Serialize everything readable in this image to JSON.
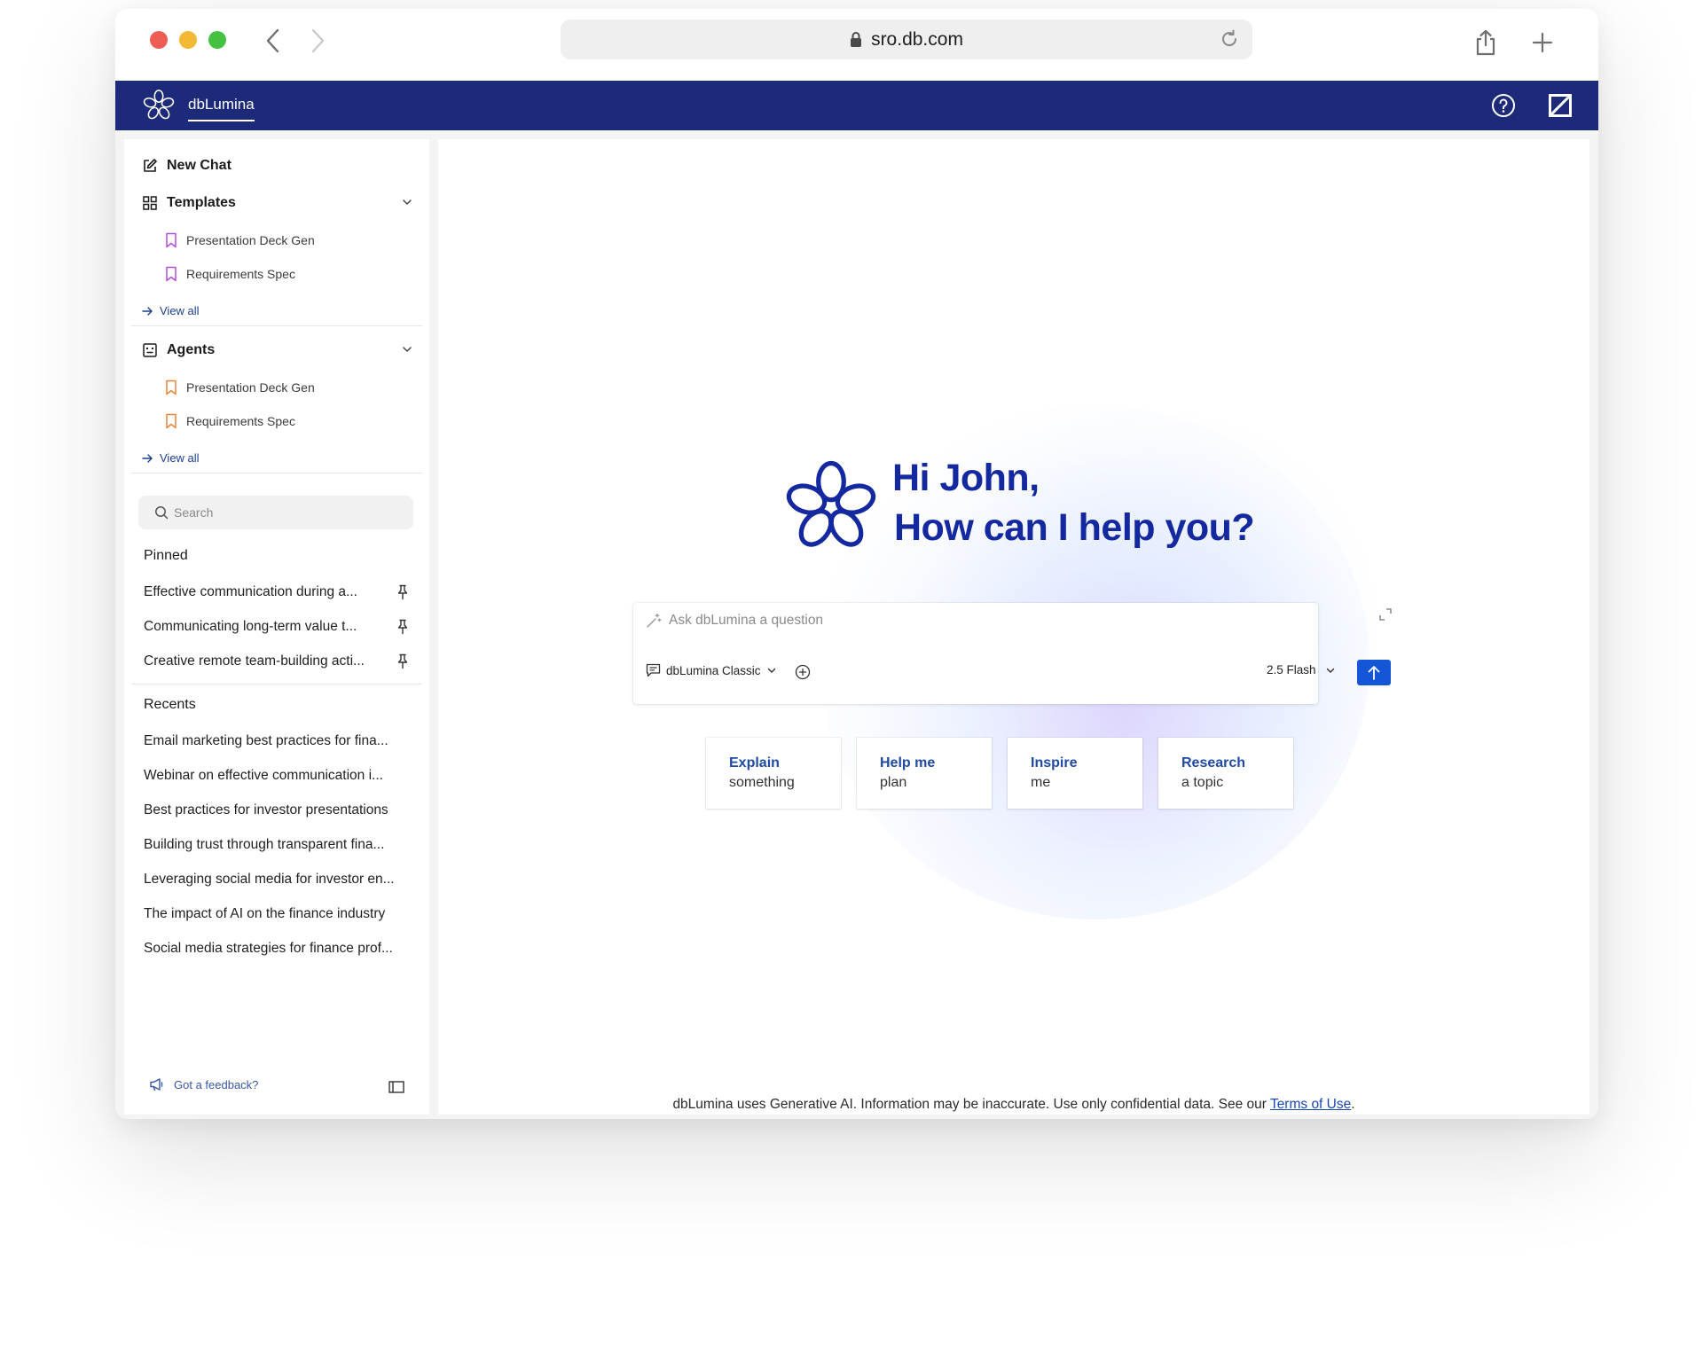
{
  "browser": {
    "url": "sro.db.com"
  },
  "header": {
    "app_title": "dbLumina"
  },
  "sidebar": {
    "new_chat": "New Chat",
    "templates": {
      "title": "Templates",
      "items": [
        "Presentation Deck Gen",
        "Requirements Spec"
      ],
      "view_all": "View all"
    },
    "agents": {
      "title": "Agents",
      "items": [
        "Presentation Deck Gen",
        "Requirements Spec"
      ],
      "view_all": "View all"
    },
    "search_placeholder": "Search",
    "pinned": {
      "title": "Pinned",
      "items": [
        "Effective communication during a...",
        "Communicating long-term value t...",
        "Creative remote team-building acti..."
      ]
    },
    "recents": {
      "title": "Recents",
      "items": [
        "Email marketing best practices for fina...",
        "Webinar on effective communication i...",
        "Best practices for investor presentations",
        "Building trust through transparent fina...",
        "Leveraging social media for investor en...",
        "The impact of AI on the finance industry",
        "Social media strategies for finance prof..."
      ]
    },
    "feedback": "Got a feedback?"
  },
  "main": {
    "greeting_line1": "Hi John,",
    "greeting_line2": "How can I help you?",
    "composer": {
      "placeholder": "Ask dbLumina a question",
      "mode": "dbLumina Classic",
      "model": "2.5 Flash"
    },
    "chips": [
      {
        "title": "Explain",
        "subtitle": "something"
      },
      {
        "title": "Help me",
        "subtitle": "plan"
      },
      {
        "title": "Inspire",
        "subtitle": "me"
      },
      {
        "title": "Research",
        "subtitle": "a topic"
      }
    ],
    "disclaimer_text": "dbLumina uses Generative AI. Information may be inaccurate. Use only confidential data. See our ",
    "disclaimer_link": "Terms of Use",
    "disclaimer_end": "."
  },
  "colors": {
    "header_bg": "#1c2a79",
    "brand_blue": "#1428a0",
    "send_button": "#1556d6",
    "template_bookmark": "#b14fd6",
    "agent_bookmark": "#e8843a"
  },
  "icons": {
    "back": "chevron-left-icon",
    "forward": "chevron-right-icon",
    "lock": "lock-icon",
    "reload": "reload-icon",
    "share": "share-icon",
    "new_tab": "plus-icon",
    "help": "help-circle-icon",
    "brand_mark": "db-slash-logo"
  }
}
